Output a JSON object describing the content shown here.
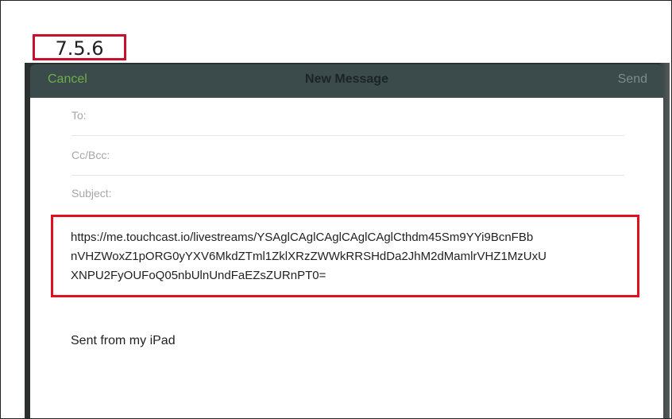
{
  "step_label": "7.5.6",
  "navbar": {
    "cancel_label": "Cancel",
    "title": "New Message",
    "send_label": "Send"
  },
  "fields": {
    "to_label": "To:",
    "cc_bcc_label": "Cc/Bcc:",
    "subject_label": "Subject:"
  },
  "body": {
    "link_lines": [
      "https://me.touchcast.io/livestreams/YSAglCAglCAglCAglCAglCthdm45Sm9YYi9BcnFBb",
      "nVHZWoxZ1pORG0yYXV6MkdZTml1ZklXRzZWWkRRSHdDa2JhM2dMamlrVHZ1MzUxU",
      "XNPU2FyOUFoQ05nbUlnUndFaEZsZURnPT0="
    ],
    "signature": "Sent from my iPad"
  },
  "colors": {
    "highlight_red": "#e0101f",
    "cancel_green": "#6fae4a",
    "navbar_bg": "#3b4a4b"
  }
}
